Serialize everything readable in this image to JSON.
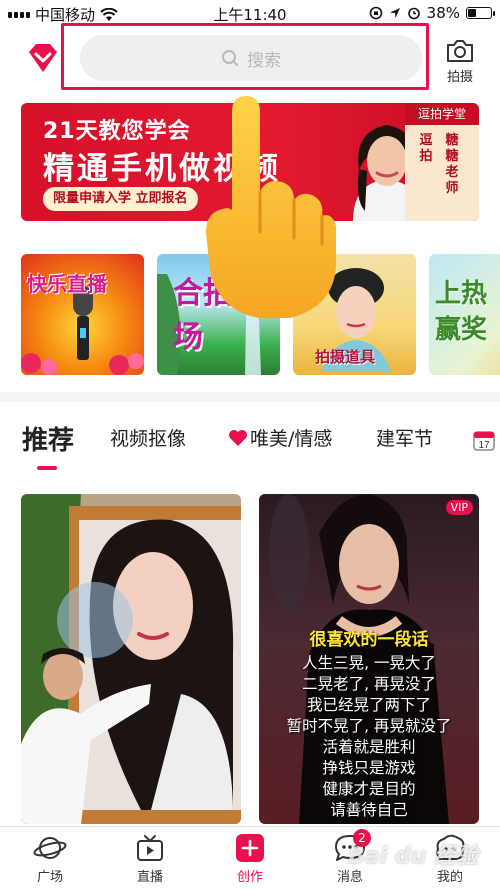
{
  "status_bar": {
    "carrier": "中国移动",
    "time": "上午11:40",
    "battery": "38%",
    "battery_level": 0.38
  },
  "header": {
    "search_placeholder": "搜索",
    "camera_label": "拍摄"
  },
  "banner": {
    "line1": "21天教您学会",
    "line2": "精通手机做视频",
    "cta": "限量申请入学 立即报名",
    "brand_tag": "逗拍学堂",
    "col1": "逗拍",
    "col2": "糖糖老师"
  },
  "categories": [
    {
      "title": "快乐直播"
    },
    {
      "title": "合拍广场"
    },
    {
      "title": "拍摄道具"
    },
    {
      "title": "上热赢奖"
    }
  ],
  "tabs": [
    {
      "label": "推荐"
    },
    {
      "label": "视频抠像"
    },
    {
      "label": "唯美/情感"
    },
    {
      "label": "建军节"
    }
  ],
  "feed": {
    "card2_vip": "VIP",
    "poem_title": "很喜欢的一段话",
    "poem_lines": [
      "人生三晃, 一晃大了",
      "二晃老了, 再晃没了",
      "我已经晃了两下了",
      "暂时不晃了, 再晃就没了",
      "活着就是胜利",
      "挣钱只是游戏",
      "健康才是目的",
      "请善待自己"
    ]
  },
  "bottom_nav": [
    {
      "label": "广场",
      "icon": "planet-icon"
    },
    {
      "label": "直播",
      "icon": "tv-icon"
    },
    {
      "label": "创作",
      "icon": "plus-icon"
    },
    {
      "label": "消息",
      "icon": "chat-icon",
      "badge": "2"
    },
    {
      "label": "我的",
      "icon": "profile-icon"
    }
  ],
  "watermark": "Bai du 经验",
  "colors": {
    "accent": "#e8114c",
    "banner_red": "#d7102a"
  }
}
